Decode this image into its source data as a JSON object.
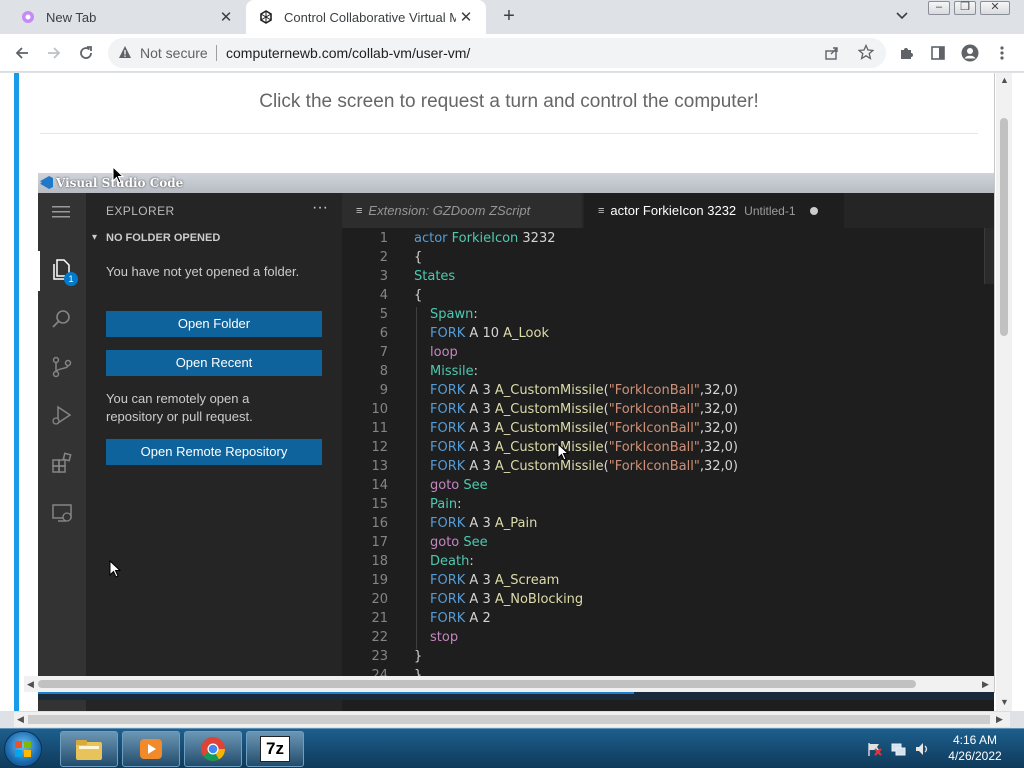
{
  "browser": {
    "tabs": [
      {
        "title": "New Tab",
        "active": false
      },
      {
        "title": "Control Collaborative Virtual Ma",
        "active": true
      }
    ],
    "address": {
      "security_label": "Not secure",
      "url": "computernewb.com/collab-vm/user-vm/"
    }
  },
  "page": {
    "prompt": "Click the screen to request a turn and control the computer!"
  },
  "vm": {
    "window_title": "Visual Studio Code",
    "sidebar": {
      "title": "EXPLORER",
      "more": "···",
      "section": "NO FOLDER OPENED",
      "msg1": "You have not yet opened a folder.",
      "btn_open_folder": "Open Folder",
      "btn_open_recent": "Open Recent",
      "msg2": "You can remotely open a repository or pull request.",
      "btn_open_remote": "Open Remote Repository",
      "explorer_badge": "1"
    },
    "editor_tabs": [
      {
        "label": "Extension: GZDoom ZScript",
        "active": false
      },
      {
        "label": "actor ForkieIcon 3232",
        "sub": "Untitled-1",
        "active": true,
        "dirty": true
      }
    ],
    "code_lines": [
      {
        "n": "1",
        "indent": 0,
        "tokens": [
          [
            "kw",
            "actor"
          ],
          [
            "nm",
            " "
          ],
          [
            "ty",
            "ForkieIcon"
          ],
          [
            "nm",
            " 3232"
          ]
        ]
      },
      {
        "n": "2",
        "indent": 0,
        "tokens": [
          [
            "nm",
            "{"
          ]
        ]
      },
      {
        "n": "3",
        "indent": 0,
        "tokens": [
          [
            "ty",
            "States"
          ]
        ]
      },
      {
        "n": "4",
        "indent": 0,
        "tokens": [
          [
            "nm",
            "{"
          ]
        ]
      },
      {
        "n": "5",
        "indent": 1,
        "tokens": [
          [
            "ty",
            "Spawn"
          ],
          [
            "nm",
            ":"
          ]
        ]
      },
      {
        "n": "6",
        "indent": 1,
        "tokens": [
          [
            "kw",
            "FORK"
          ],
          [
            "nm",
            " A 10 "
          ],
          [
            "fn",
            "A_Look"
          ]
        ]
      },
      {
        "n": "7",
        "indent": 1,
        "tokens": [
          [
            "ctl",
            "loop"
          ]
        ]
      },
      {
        "n": "8",
        "indent": 1,
        "tokens": [
          [
            "ty",
            "Missile"
          ],
          [
            "nm",
            ":"
          ]
        ]
      },
      {
        "n": "9",
        "indent": 1,
        "tokens": [
          [
            "kw",
            "FORK"
          ],
          [
            "nm",
            " A 3 "
          ],
          [
            "fn",
            "A_CustomMissile"
          ],
          [
            "nm",
            "("
          ],
          [
            "st",
            "\"ForkIconBall\""
          ],
          [
            "nm",
            ",32,0)"
          ]
        ]
      },
      {
        "n": "10",
        "indent": 1,
        "tokens": [
          [
            "kw",
            "FORK"
          ],
          [
            "nm",
            " A 3 "
          ],
          [
            "fn",
            "A_CustomMissile"
          ],
          [
            "nm",
            "("
          ],
          [
            "st",
            "\"ForkIconBall\""
          ],
          [
            "nm",
            ",32,0)"
          ]
        ]
      },
      {
        "n": "11",
        "indent": 1,
        "tokens": [
          [
            "kw",
            "FORK"
          ],
          [
            "nm",
            " A 3 "
          ],
          [
            "fn",
            "A_CustomMissile"
          ],
          [
            "nm",
            "("
          ],
          [
            "st",
            "\"ForkIconBall\""
          ],
          [
            "nm",
            ",32,0)"
          ]
        ]
      },
      {
        "n": "12",
        "indent": 1,
        "tokens": [
          [
            "kw",
            "FORK"
          ],
          [
            "nm",
            " A 3 "
          ],
          [
            "fn",
            "A_CustomMissile"
          ],
          [
            "nm",
            "("
          ],
          [
            "st",
            "\"ForkIconBall\""
          ],
          [
            "nm",
            ",32,0)"
          ]
        ]
      },
      {
        "n": "13",
        "indent": 1,
        "tokens": [
          [
            "kw",
            "FORK"
          ],
          [
            "nm",
            " A 3 "
          ],
          [
            "fn",
            "A_CustomMissile"
          ],
          [
            "nm",
            "("
          ],
          [
            "st",
            "\"ForkIconBall\""
          ],
          [
            "nm",
            ",32,0)"
          ]
        ]
      },
      {
        "n": "14",
        "indent": 1,
        "tokens": [
          [
            "ctl",
            "goto"
          ],
          [
            "nm",
            " "
          ],
          [
            "ty",
            "See"
          ]
        ]
      },
      {
        "n": "15",
        "indent": 1,
        "tokens": [
          [
            "ty",
            "Pain"
          ],
          [
            "nm",
            ":"
          ]
        ]
      },
      {
        "n": "16",
        "indent": 1,
        "tokens": [
          [
            "kw",
            "FORK"
          ],
          [
            "nm",
            " A 3 "
          ],
          [
            "fn",
            "A_Pain"
          ]
        ]
      },
      {
        "n": "17",
        "indent": 1,
        "tokens": [
          [
            "ctl",
            "goto"
          ],
          [
            "nm",
            " "
          ],
          [
            "ty",
            "See"
          ]
        ]
      },
      {
        "n": "18",
        "indent": 1,
        "tokens": [
          [
            "ty",
            "Death"
          ],
          [
            "nm",
            ":"
          ]
        ]
      },
      {
        "n": "19",
        "indent": 1,
        "tokens": [
          [
            "kw",
            "FORK"
          ],
          [
            "nm",
            " A 3 "
          ],
          [
            "fn",
            "A_Scream"
          ]
        ]
      },
      {
        "n": "20",
        "indent": 1,
        "tokens": [
          [
            "kw",
            "FORK"
          ],
          [
            "nm",
            " A 3 "
          ],
          [
            "fn",
            "A_NoBlocking"
          ]
        ]
      },
      {
        "n": "21",
        "indent": 1,
        "tokens": [
          [
            "kw",
            "FORK"
          ],
          [
            "nm",
            " A 2"
          ]
        ]
      },
      {
        "n": "22",
        "indent": 1,
        "tokens": [
          [
            "ctl",
            "stop"
          ]
        ]
      },
      {
        "n": "23",
        "indent": 0,
        "tokens": [
          [
            "nm",
            "}"
          ]
        ]
      },
      {
        "n": "24",
        "indent": 0,
        "tokens": [
          [
            "nm",
            "}"
          ]
        ]
      }
    ]
  },
  "taskbar": {
    "time": "4:16 AM",
    "date": "4/26/2022",
    "apps": [
      "explorer",
      "media-player",
      "chrome",
      "7zip"
    ],
    "sevenzip_label": "7z"
  }
}
